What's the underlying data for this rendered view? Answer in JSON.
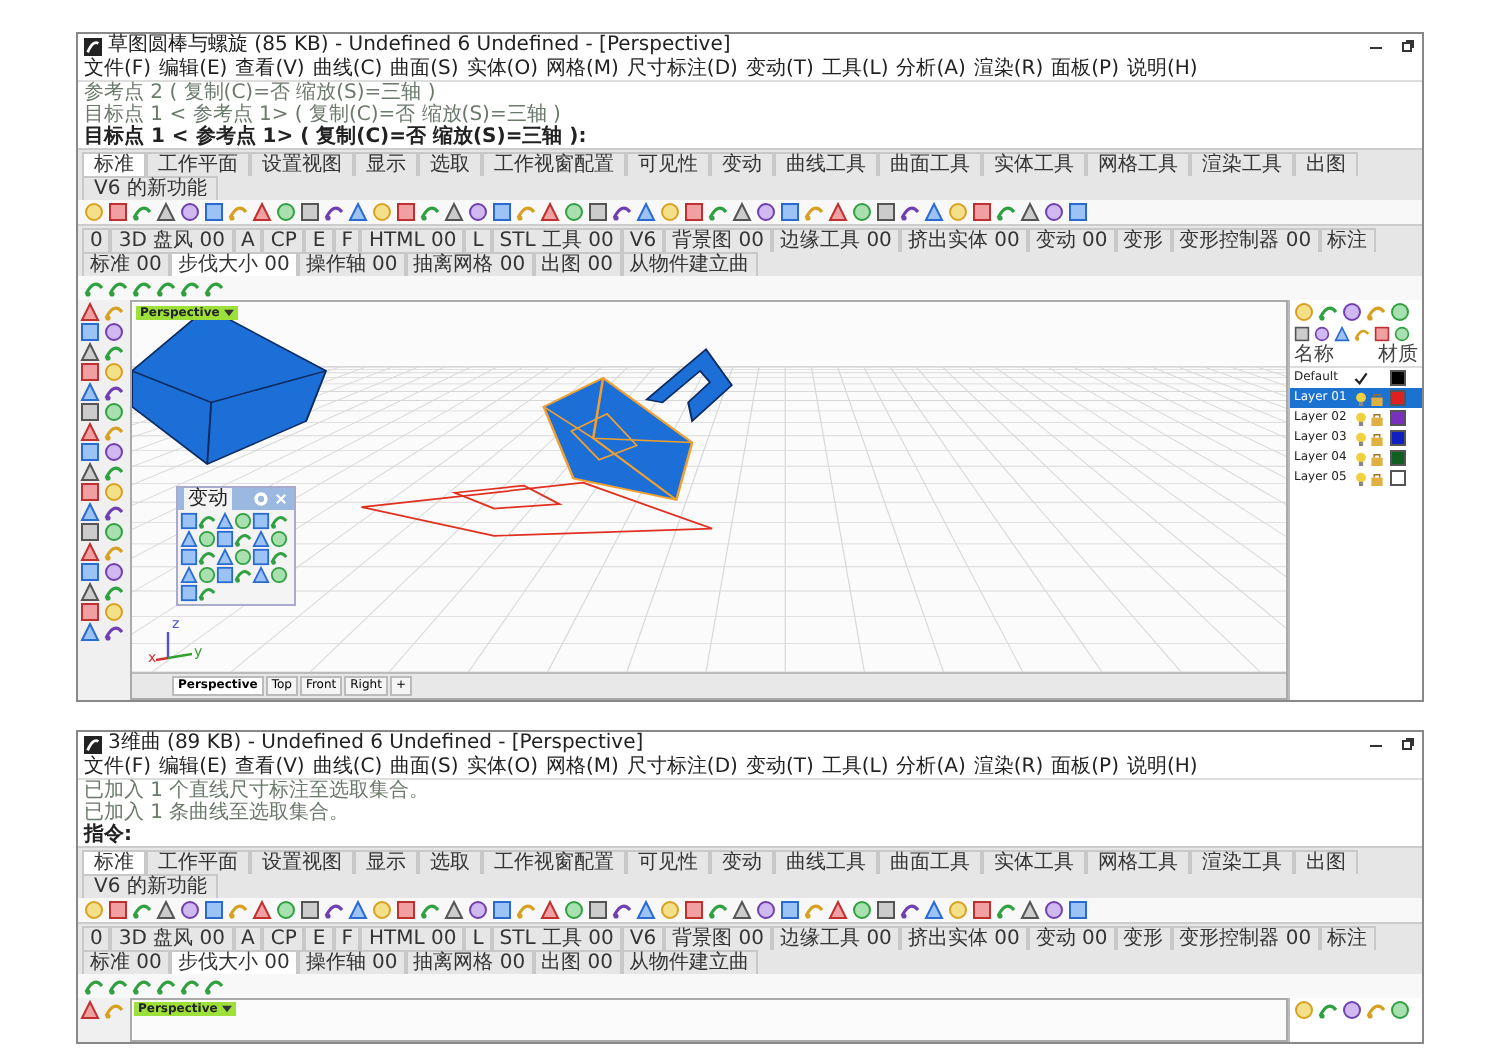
{
  "top_window": {
    "title": "草图圆棒与螺旋 (85 KB) - Undefined 6 Undefined - [Perspective]",
    "menu": [
      "文件(F)",
      "编辑(E)",
      "查看(V)",
      "曲线(C)",
      "曲面(S)",
      "实体(O)",
      "网格(M)",
      "尺寸标注(D)",
      "变动(T)",
      "工具(L)",
      "分析(A)",
      "渲染(R)",
      "面板(P)",
      "说明(H)"
    ],
    "command_lines": [
      {
        "text": "参考点 2 ( 复制(C)=否 缩放(S)=三轴 )",
        "kind": "history"
      },
      {
        "text": "目标点 1 < 参考点 1> ( 复制(C)=否 缩放(S)=三轴 )",
        "kind": "history"
      },
      {
        "text": "目标点 1 < 参考点 1> ( 复制(C)=否 缩放(S)=三轴 ):",
        "kind": "prompt"
      }
    ],
    "tabs": [
      {
        "label": "标准",
        "selected": true
      },
      {
        "label": "工作平面",
        "selected": false
      },
      {
        "label": "设置视图",
        "selected": false
      },
      {
        "label": "显示",
        "selected": false
      },
      {
        "label": "选取",
        "selected": false
      },
      {
        "label": "工作视窗配置",
        "selected": false
      },
      {
        "label": "可见性",
        "selected": false
      },
      {
        "label": "变动",
        "selected": false
      },
      {
        "label": "曲线工具",
        "selected": false
      },
      {
        "label": "曲面工具",
        "selected": false
      },
      {
        "label": "实体工具",
        "selected": false
      },
      {
        "label": "网格工具",
        "selected": false
      },
      {
        "label": "渲染工具",
        "selected": false
      },
      {
        "label": "出图",
        "selected": false
      },
      {
        "label": "V6 的新功能",
        "selected": false
      }
    ],
    "toolbar_tabs": [
      {
        "label": "0",
        "selected": false
      },
      {
        "label": "3D 盘风 00",
        "selected": false
      },
      {
        "label": "A",
        "selected": false
      },
      {
        "label": "CP",
        "selected": false
      },
      {
        "label": "E",
        "selected": false
      },
      {
        "label": "F",
        "selected": false
      },
      {
        "label": "HTML 00",
        "selected": false
      },
      {
        "label": "L",
        "selected": false
      },
      {
        "label": "STL 工具 00",
        "selected": false
      },
      {
        "label": "V6",
        "selected": false
      },
      {
        "label": "背景图 00",
        "selected": false
      },
      {
        "label": "边缘工具 00",
        "selected": false
      },
      {
        "label": "挤出实体 00",
        "selected": false
      },
      {
        "label": "变动 00",
        "selected": false
      },
      {
        "label": "变形",
        "selected": false
      },
      {
        "label": "变形控制器 00",
        "selected": false
      },
      {
        "label": "标注",
        "selected": false
      },
      {
        "label": "标准 00",
        "selected": false
      },
      {
        "label": "步伐大小 00",
        "selected": true
      },
      {
        "label": "操作轴 00",
        "selected": false
      },
      {
        "label": "抽离网格 00",
        "selected": false
      },
      {
        "label": "出图 00",
        "selected": false
      },
      {
        "label": "从物件建立曲",
        "selected": false
      }
    ],
    "viewport": {
      "label": "Perspective",
      "axis_labels": [
        "x",
        "y",
        "z"
      ],
      "view_tabs": [
        {
          "label": "Perspective",
          "selected": true
        },
        {
          "label": "Top",
          "selected": false
        },
        {
          "label": "Front",
          "selected": false
        },
        {
          "label": "Right",
          "selected": false
        },
        {
          "label": "+",
          "selected": false
        }
      ]
    },
    "floating_toolbar": {
      "title": "变动"
    },
    "layers_panel": {
      "columns": [
        "名称",
        "材质"
      ],
      "layers": [
        {
          "name": "Default",
          "current": true,
          "selected": false,
          "color": "#000000"
        },
        {
          "name": "Layer 01",
          "current": false,
          "selected": true,
          "color": "#e02020"
        },
        {
          "name": "Layer 02",
          "current": false,
          "selected": false,
          "color": "#7b2fbe"
        },
        {
          "name": "Layer 03",
          "current": false,
          "selected": false,
          "color": "#1020c0"
        },
        {
          "name": "Layer 04",
          "current": false,
          "selected": false,
          "color": "#106020"
        },
        {
          "name": "Layer 05",
          "current": false,
          "selected": false,
          "color": "#ffffff"
        }
      ]
    }
  },
  "bottom_window": {
    "title": "3维曲 (89 KB) - Undefined 6 Undefined - [Perspective]",
    "menu": [
      "文件(F)",
      "编辑(E)",
      "查看(V)",
      "曲线(C)",
      "曲面(S)",
      "实体(O)",
      "网格(M)",
      "尺寸标注(D)",
      "变动(T)",
      "工具(L)",
      "分析(A)",
      "渲染(R)",
      "面板(P)",
      "说明(H)"
    ],
    "command_lines": [
      {
        "text": "已加入 1 个直线尺寸标注至选取集合。",
        "kind": "history"
      },
      {
        "text": "已加入 1 条曲线至选取集合。",
        "kind": "history"
      },
      {
        "text": "指令:",
        "kind": "prompt"
      }
    ],
    "tabs": [
      {
        "label": "标准",
        "selected": true
      },
      {
        "label": "工作平面",
        "selected": false
      },
      {
        "label": "设置视图",
        "selected": false
      },
      {
        "label": "显示",
        "selected": false
      },
      {
        "label": "选取",
        "selected": false
      },
      {
        "label": "工作视窗配置",
        "selected": false
      },
      {
        "label": "可见性",
        "selected": false
      },
      {
        "label": "变动",
        "selected": false
      },
      {
        "label": "曲线工具",
        "selected": false
      },
      {
        "label": "曲面工具",
        "selected": false
      },
      {
        "label": "实体工具",
        "selected": false
      },
      {
        "label": "网格工具",
        "selected": false
      },
      {
        "label": "渲染工具",
        "selected": false
      },
      {
        "label": "出图",
        "selected": false
      },
      {
        "label": "V6 的新功能",
        "selected": false
      }
    ],
    "toolbar_tabs": [
      {
        "label": "0",
        "selected": false
      },
      {
        "label": "3D 盘风 00",
        "selected": false
      },
      {
        "label": "A",
        "selected": false
      },
      {
        "label": "CP",
        "selected": false
      },
      {
        "label": "E",
        "selected": false
      },
      {
        "label": "F",
        "selected": false
      },
      {
        "label": "HTML 00",
        "selected": false
      },
      {
        "label": "L",
        "selected": false
      },
      {
        "label": "STL 工具 00",
        "selected": false
      },
      {
        "label": "V6",
        "selected": false
      },
      {
        "label": "背景图 00",
        "selected": false
      },
      {
        "label": "边缘工具 00",
        "selected": false
      },
      {
        "label": "挤出实体 00",
        "selected": false
      },
      {
        "label": "变动 00",
        "selected": false
      },
      {
        "label": "变形",
        "selected": false
      },
      {
        "label": "变形控制器 00",
        "selected": false
      },
      {
        "label": "标注",
        "selected": false
      },
      {
        "label": "标准 00",
        "selected": false
      },
      {
        "label": "步伐大小 00",
        "selected": true
      },
      {
        "label": "操作轴 00",
        "selected": false
      },
      {
        "label": "抽离网格 00",
        "selected": false
      },
      {
        "label": "出图 00",
        "selected": false
      },
      {
        "label": "从物件建立曲",
        "selected": false
      }
    ],
    "viewport": {
      "label": "Perspective"
    }
  }
}
